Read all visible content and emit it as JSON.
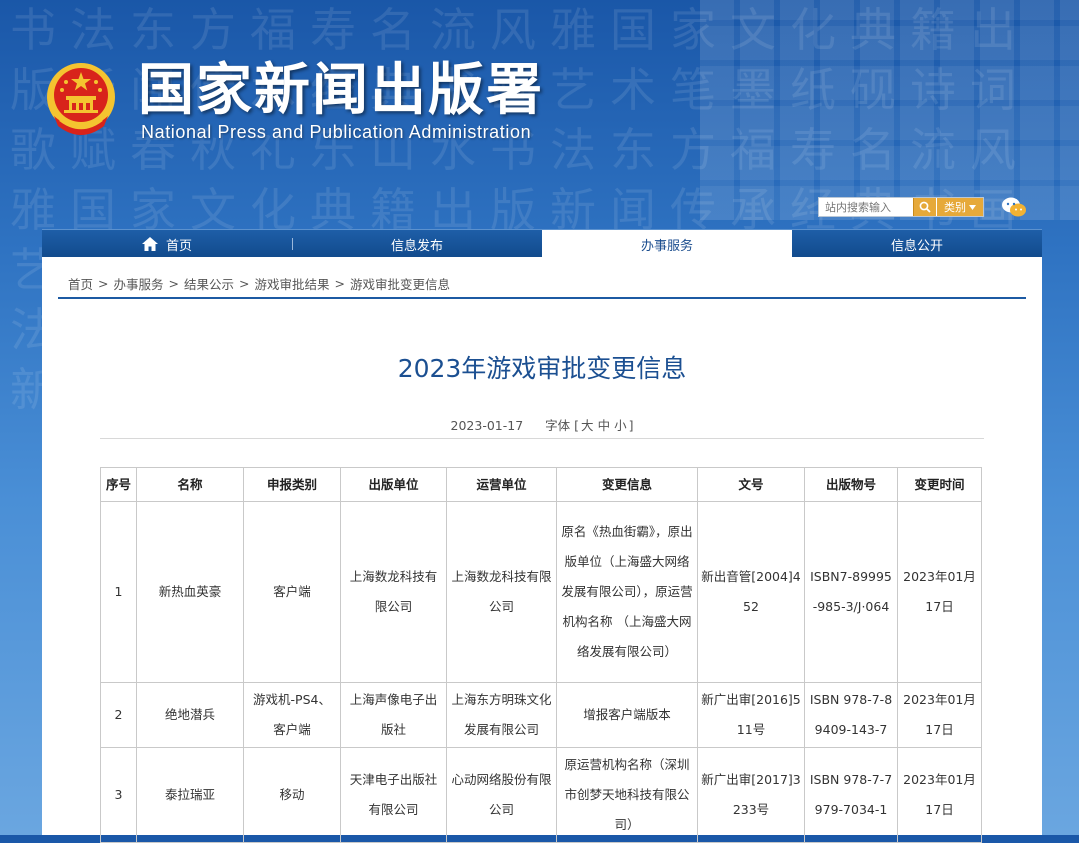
{
  "header": {
    "site_title": "国家新闻出版署",
    "site_subtitle": "National Press and Publication Administration",
    "search_placeholder": "站内搜索输入",
    "search_category": "类别"
  },
  "nav": {
    "items": [
      {
        "label": "首页"
      },
      {
        "label": "信息发布"
      },
      {
        "label": "办事服务"
      },
      {
        "label": "信息公开"
      }
    ]
  },
  "breadcrumb": {
    "items": [
      "首页",
      "办事服务",
      "结果公示",
      "游戏审批结果",
      "游戏审批变更信息"
    ],
    "separator": ">"
  },
  "article": {
    "title": "2023年游戏审批变更信息",
    "date": "2023-01-17",
    "font_label": "字体",
    "font_open": "[",
    "font_large": "大",
    "font_medium": "中",
    "font_small": "小",
    "font_close": "]"
  },
  "table": {
    "headers": [
      "序号",
      "名称",
      "申报类别",
      "出版单位",
      "运营单位",
      "变更信息",
      "文号",
      "出版物号",
      "变更时间"
    ],
    "rows": [
      {
        "no": "1",
        "name": "新热血英豪",
        "category": "客户端",
        "publisher": "上海数龙科技有限公司",
        "operator": "上海数龙科技有限公司",
        "change": "原名《热血街霸》，原出版单位（上海盛大网络发展有限公司），原运营机构名称 （上海盛大网络发展有限公司）",
        "doc_no": "新出音管[2004]452",
        "isbn": "ISBN7-89995-985-3/J·064",
        "date": "2023年01月17日"
      },
      {
        "no": "2",
        "name": "绝地潜兵",
        "category": "游戏机-PS4、客户端",
        "publisher": "上海声像电子出版社",
        "operator": "上海东方明珠文化发展有限公司",
        "change": "增报客户端版本",
        "doc_no": "新广出审[2016]511号",
        "isbn": "ISBN 978-7-89409-143-7",
        "date": "2023年01月17日"
      },
      {
        "no": "3",
        "name": "泰拉瑞亚",
        "category": "移动",
        "publisher": "天津电子出版社有限公司",
        "operator": "心动网络股份有限公司",
        "change": "原运营机构名称（深圳市创梦天地科技有限公司）",
        "doc_no": "新广出审[2017]3233号",
        "isbn": "ISBN 978-7-7979-7034-1",
        "date": "2023年01月17日"
      }
    ]
  },
  "colors": {
    "nav_bg": "#114a8c",
    "title_blue": "#1b4f91",
    "accent_orange": "#e6a93a",
    "emblem_red": "#d8231b",
    "emblem_gold": "#f4c430"
  }
}
